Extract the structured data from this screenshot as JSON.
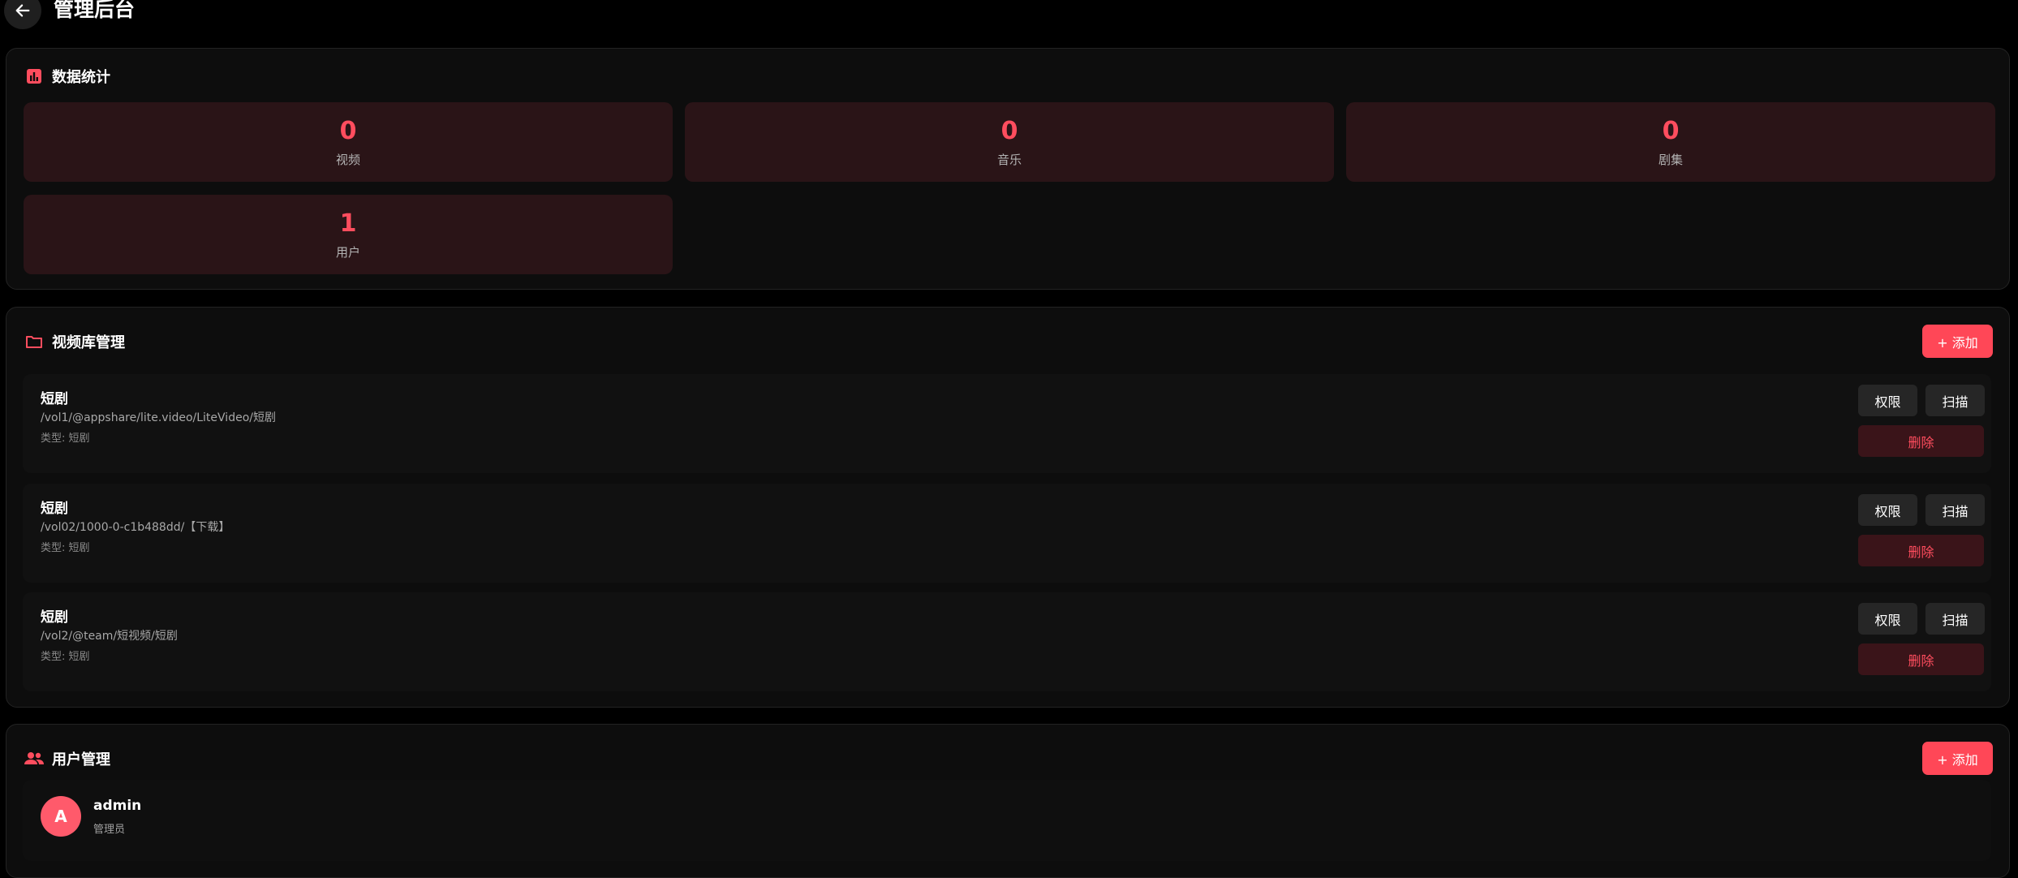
{
  "header": {
    "title": "管理后台",
    "back_icon": "arrow-left-icon"
  },
  "stats": {
    "title": "数据统计",
    "icon": "bar-chart-icon",
    "items": [
      {
        "value": "0",
        "label": "视频"
      },
      {
        "value": "0",
        "label": "音乐"
      },
      {
        "value": "0",
        "label": "剧集"
      },
      {
        "value": "1",
        "label": "用户"
      }
    ]
  },
  "libraries": {
    "title": "视频库管理",
    "icon": "folder-icon",
    "add_label": "+ 添加",
    "items": [
      {
        "name": "短剧",
        "path": "/vol1/@appshare/lite.video/LiteVideo/短剧",
        "type": "类型: 短剧",
        "perm": "权限",
        "scan": "扫描",
        "delete": "删除"
      },
      {
        "name": "短剧",
        "path": "/vol02/1000-0-c1b488dd/【下载】",
        "type": "类型: 短剧",
        "perm": "权限",
        "scan": "扫描",
        "delete": "删除"
      },
      {
        "name": "短剧",
        "path": "/vol2/@team/短视频/短剧",
        "type": "类型: 短剧",
        "perm": "权限",
        "scan": "扫描",
        "delete": "删除"
      }
    ]
  },
  "users": {
    "title": "用户管理",
    "icon": "users-icon",
    "add_label": "+ 添加",
    "items": [
      {
        "avatar": "A",
        "name": "admin",
        "role": "管理员"
      }
    ]
  },
  "colors": {
    "accent": "#ff4757",
    "accent_text": "#ff4d5e",
    "card_bg": "#0d0d0d",
    "stat_bg": "#2a1417"
  }
}
